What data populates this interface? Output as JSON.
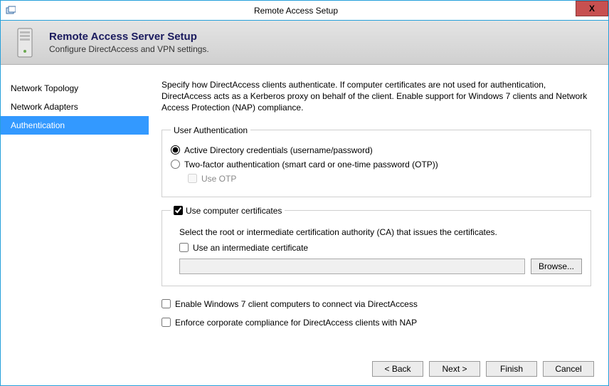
{
  "window": {
    "title": "Remote Access Setup",
    "close": "X"
  },
  "header": {
    "title": "Remote Access Server Setup",
    "subtitle": "Configure DirectAccess and VPN settings."
  },
  "sidebar": {
    "items": [
      {
        "label": "Network Topology"
      },
      {
        "label": "Network Adapters"
      },
      {
        "label": "Authentication"
      }
    ],
    "selected_index": 2
  },
  "content": {
    "description": "Specify how DirectAccess clients authenticate. If computer certificates are not used for authentication, DirectAccess acts as a Kerberos proxy on behalf of the client. Enable support for Windows 7 clients and Network Access Protection (NAP) compliance.",
    "user_auth": {
      "legend": "User Authentication",
      "radio_ad": "Active Directory credentials (username/password)",
      "radio_twofactor": "Two-factor authentication (smart card or one-time password (OTP))",
      "use_otp": "Use OTP",
      "selected": "ad"
    },
    "cert": {
      "legend": "Use computer certificates",
      "checked": true,
      "desc": "Select the root or intermediate certification authority (CA) that issues the certificates.",
      "use_intermediate": "Use an intermediate certificate",
      "browse": "Browse..."
    },
    "opt_win7": "Enable Windows 7 client computers to connect via DirectAccess",
    "opt_nap": "Enforce corporate compliance for DirectAccess clients with NAP"
  },
  "buttons": {
    "back": "< Back",
    "next": "Next >",
    "finish": "Finish",
    "cancel": "Cancel"
  }
}
